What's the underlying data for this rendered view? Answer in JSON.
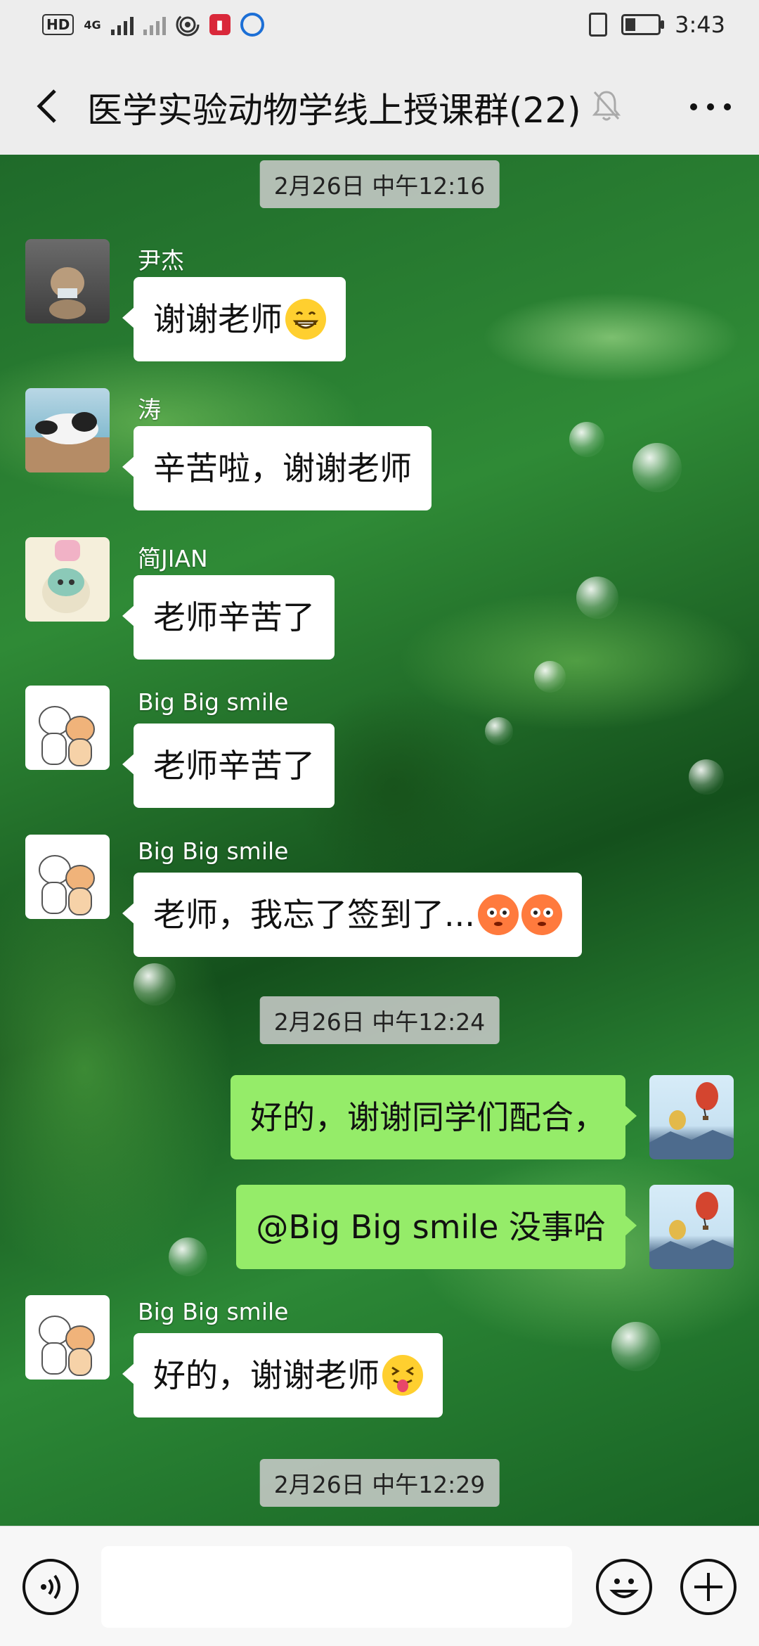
{
  "status_bar": {
    "left_chip": "HD",
    "network": "4G",
    "time": "3:43",
    "icons": [
      "signal-icon",
      "no-signal-icon",
      "hotspot-icon",
      "app-red-icon",
      "app-blue-icon",
      "vibrate-icon",
      "battery-icon"
    ]
  },
  "header": {
    "title": "医学实验动物学线上授课群(22)",
    "back_icon": "chevron-left-icon",
    "mute_icon": "bell-muted-icon",
    "more_icon": "more-dots-icon"
  },
  "chat": {
    "timestamps": [
      "2月26日 中午12:16",
      "2月26日 中午12:24",
      "2月26日 中午12:29"
    ],
    "messages": [
      {
        "sender": "尹杰",
        "text": "谢谢老师",
        "emoji": "grinning-face-icon",
        "side": "left"
      },
      {
        "sender": "涛",
        "text": "辛苦啦，谢谢老师",
        "side": "left"
      },
      {
        "sender": "简JIAN",
        "text": "老师辛苦了",
        "side": "left"
      },
      {
        "sender": "Big Big smile",
        "text": "老师辛苦了",
        "side": "left"
      },
      {
        "sender": "Big Big smile",
        "text": "老师，我忘了签到了...",
        "emoji": "flushed-face-icon",
        "side": "left"
      },
      {
        "text": "好的，谢谢同学们配合，",
        "side": "right"
      },
      {
        "text": "@Big Big smile  没事哈",
        "side": "right"
      },
      {
        "sender": "Big Big smile",
        "text": "好的，谢谢老师",
        "emoji": "squinting-tongue-face-icon",
        "side": "left"
      }
    ]
  },
  "bottom_bar": {
    "voice_icon": "voice-icon",
    "emoji_icon": "smiley-icon",
    "plus_icon": "plus-icon"
  },
  "colors": {
    "self_bubble": "#95ec69",
    "other_bubble": "#ffffff",
    "bar_bg": "#ededed"
  }
}
